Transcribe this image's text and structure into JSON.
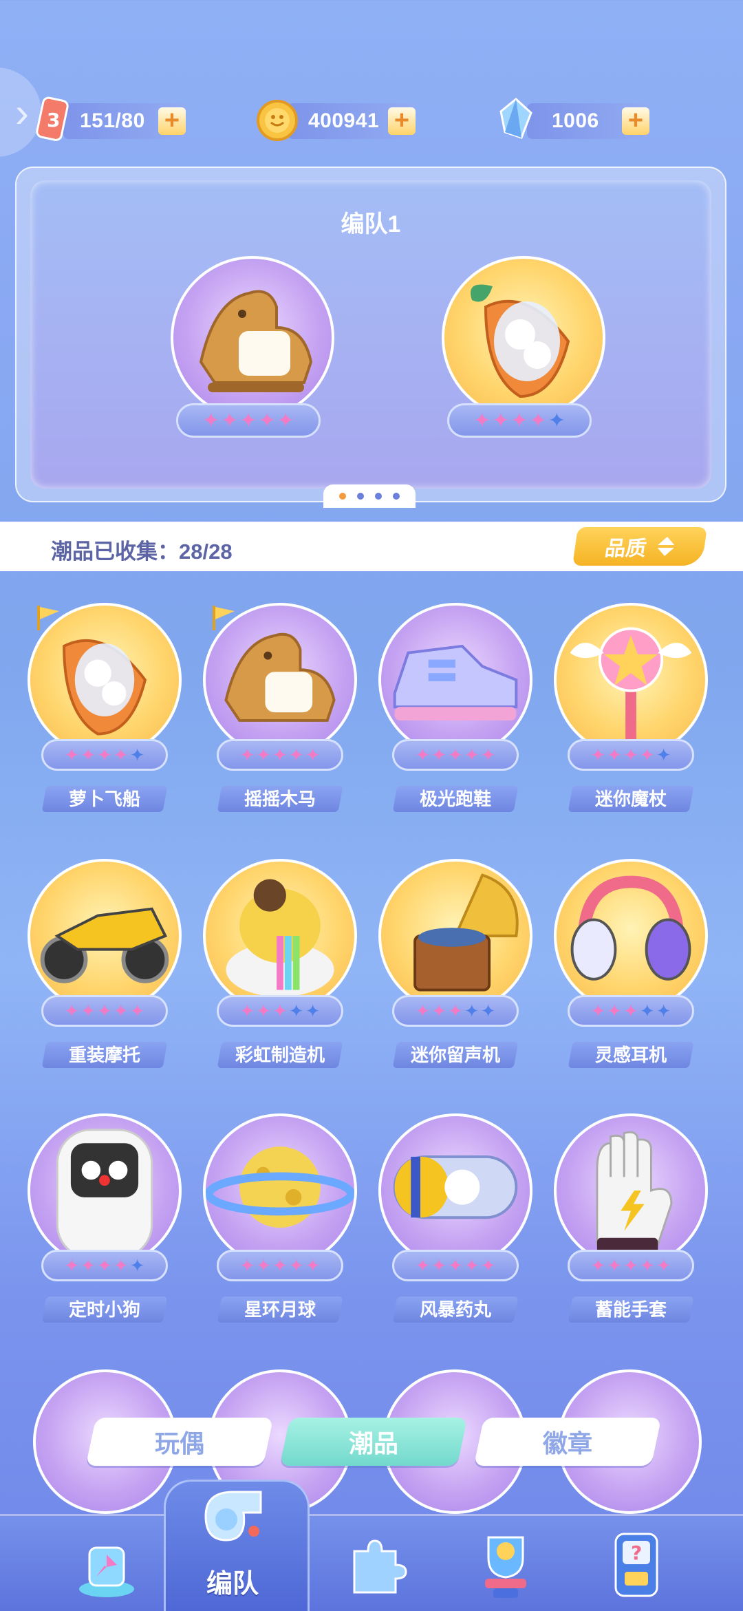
{
  "resources": [
    {
      "name": "stamina",
      "value": "151/80",
      "icon": "ticket-icon"
    },
    {
      "name": "coins",
      "value": "400941",
      "icon": "gold-coin-icon"
    },
    {
      "name": "crystals",
      "value": "1006",
      "icon": "crystal-icon"
    }
  ],
  "team": {
    "title": "编队1",
    "slots": [
      {
        "item": "rocking-horse",
        "stars": 5,
        "max_stars": 5
      },
      {
        "item": "carrot-ship",
        "stars": 4,
        "max_stars": 5
      }
    ],
    "page_count": 4,
    "active_page": 1
  },
  "collection": {
    "label": "潮品已收集：28/28",
    "sort_label": "品质"
  },
  "items": [
    {
      "name": "萝卜飞船",
      "stars": 4,
      "bg": "yellow",
      "flag": true,
      "icon": "carrot-ship-icon"
    },
    {
      "name": "摇摇木马",
      "stars": 5,
      "bg": "purple",
      "flag": true,
      "icon": "rocking-horse-icon"
    },
    {
      "name": "极光跑鞋",
      "stars": 5,
      "bg": "purple",
      "flag": false,
      "icon": "sneaker-icon"
    },
    {
      "name": "迷你魔杖",
      "stars": 4,
      "bg": "yellow",
      "flag": false,
      "icon": "magic-wand-icon"
    },
    {
      "name": "重装摩托",
      "stars": 5,
      "bg": "yellow",
      "flag": false,
      "icon": "motorcycle-icon"
    },
    {
      "name": "彩虹制造机",
      "stars": 3,
      "bg": "yellow",
      "flag": false,
      "icon": "rainbow-machine-icon"
    },
    {
      "name": "迷你留声机",
      "stars": 3,
      "bg": "yellow",
      "flag": false,
      "icon": "gramophone-icon"
    },
    {
      "name": "灵感耳机",
      "stars": 3,
      "bg": "yellow",
      "flag": false,
      "icon": "headphones-icon"
    },
    {
      "name": "定时小狗",
      "stars": 4,
      "bg": "purple",
      "flag": false,
      "icon": "timer-dog-icon"
    },
    {
      "name": "星环月球",
      "stars": 5,
      "bg": "purple",
      "flag": false,
      "icon": "ringed-moon-icon"
    },
    {
      "name": "风暴药丸",
      "stars": 5,
      "bg": "purple",
      "flag": false,
      "icon": "storm-pill-icon"
    },
    {
      "name": "蓄能手套",
      "stars": 5,
      "bg": "purple",
      "flag": false,
      "icon": "power-glove-icon"
    }
  ],
  "tabs": [
    {
      "label": "玩偶",
      "active": false
    },
    {
      "label": "潮品",
      "active": true
    },
    {
      "label": "徽章",
      "active": false
    }
  ],
  "bottom_nav": [
    {
      "icon": "pinwheel-icon",
      "label": ""
    },
    {
      "icon": "whistle-icon",
      "label": "编队",
      "active": true
    },
    {
      "icon": "puzzle-icon",
      "label": ""
    },
    {
      "icon": "trophy-icon",
      "label": ""
    },
    {
      "icon": "mystery-machine-icon",
      "label": ""
    }
  ],
  "colors": {
    "star_on": "#f37bc6",
    "star_off": "#4f7fe8",
    "accent_yellow": "#f5b324",
    "tab_active": "#73d9cc"
  }
}
